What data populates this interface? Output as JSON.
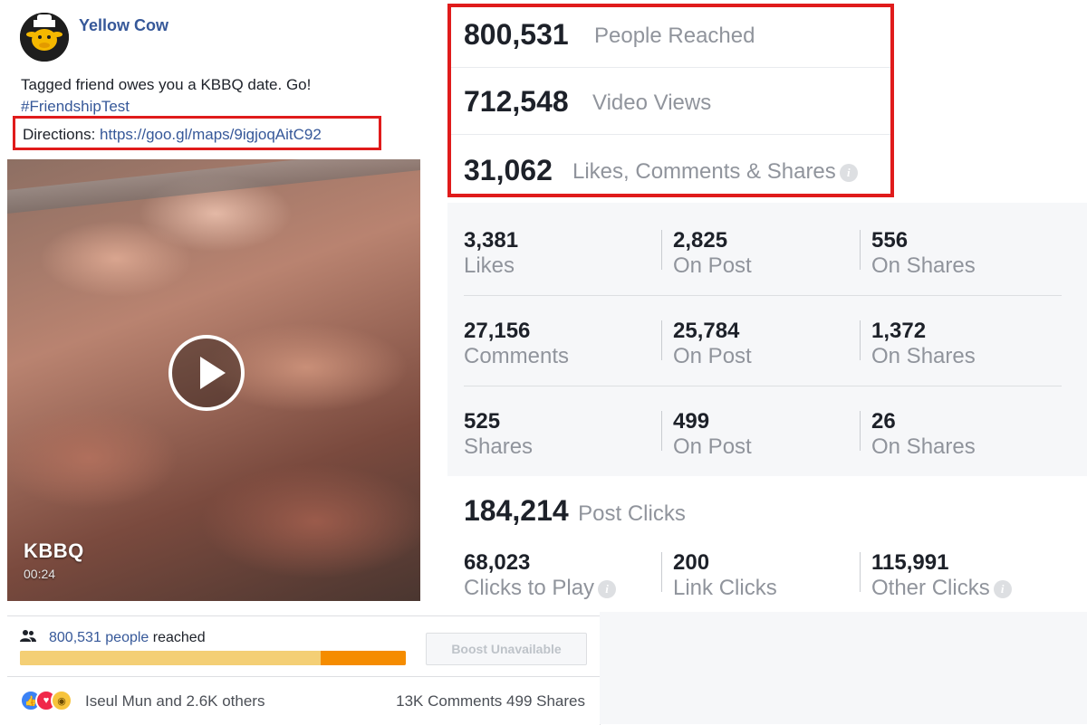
{
  "post": {
    "page_name": "Yellow Cow",
    "text_line1": "Tagged friend owes you a KBBQ date. Go!",
    "hashtag": "#FriendshipTest",
    "directions_label": "Directions:",
    "directions_url": "https://goo.gl/maps/9igjoqAitC92",
    "video_title": "KBBQ",
    "video_duration": "00:24"
  },
  "reach_panel": {
    "reach_count": "800,531 people",
    "reach_suffix": "reached",
    "progress_fraction": 0.78,
    "boost_label": "Boost Unavailable",
    "reactors": "Iseul Mun and 2.6K others",
    "comments": "13K Comments",
    "shares": "499 Shares"
  },
  "stats": {
    "top": [
      {
        "value": "800,531",
        "label": "People Reached"
      },
      {
        "value": "712,548",
        "label": "Video Views"
      },
      {
        "value": "31,062",
        "label": "Likes, Comments & Shares"
      }
    ],
    "grid": [
      [
        {
          "value": "3,381",
          "label": "Likes"
        },
        {
          "value": "2,825",
          "label": "On Post"
        },
        {
          "value": "556",
          "label": "On Shares"
        }
      ],
      [
        {
          "value": "27,156",
          "label": "Comments"
        },
        {
          "value": "25,784",
          "label": "On Post"
        },
        {
          "value": "1,372",
          "label": "On Shares"
        }
      ],
      [
        {
          "value": "525",
          "label": "Shares"
        },
        {
          "value": "499",
          "label": "On Post"
        },
        {
          "value": "26",
          "label": "On Shares"
        }
      ]
    ],
    "clicks_total": {
      "value": "184,214",
      "label": "Post Clicks"
    },
    "clicks": [
      {
        "value": "68,023",
        "label": "Clicks to Play"
      },
      {
        "value": "200",
        "label": "Link Clicks"
      },
      {
        "value": "115,991",
        "label": "Other Clicks"
      }
    ],
    "info_glyph": "i"
  },
  "colors": {
    "link": "#365899",
    "highlight": "#e01b1b",
    "progress_fill": "#f58c00"
  }
}
